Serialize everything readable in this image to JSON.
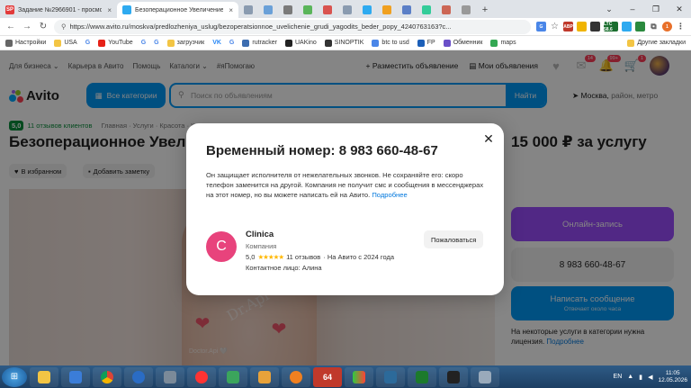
{
  "browser": {
    "tabs": [
      {
        "label": "Задание №2966901 - просмотр з",
        "fav": "SP",
        "color": "#e23a3a"
      },
      {
        "label": "Безоперационное Увеличение ]",
        "fav": "",
        "color": "#2eaaf0"
      },
      {
        "label": "",
        "fav": "",
        "color": "#8a9bb0"
      },
      {
        "label": "",
        "fav": "",
        "color": "#8a9bb0"
      },
      {
        "label": "",
        "fav": "",
        "color": "#8a9bb0"
      }
    ],
    "url": "https://www.avito.ru/moskva/predlozheniya_uslug/bezoperatsionnoe_uvelichenie_grudi_yagodits_beder_popy_4240763163?c...",
    "ext_labels": [
      "ABP",
      "LTC 58.6",
      "1"
    ],
    "bookmarks": [
      "Настройки",
      "USA",
      "G",
      "YouTube",
      "G",
      "G",
      "загрузчик",
      "VK",
      "G",
      "rutracker",
      "UAKino",
      "SINOPTIK",
      "btc to usd",
      "FP",
      "Обменник",
      "maps",
      "Другие закладки"
    ]
  },
  "avito": {
    "topnav": [
      "Для бизнеса ⌄",
      "Карьера в Авито",
      "Помощь",
      "Каталоги ⌄",
      "#яПомогаю"
    ],
    "post_ad": "+ Разместить объявление",
    "my_ads": "Мои объявления",
    "badges": {
      "messages": "14",
      "notifications": "99+",
      "cart": "1"
    },
    "logo": "Avito",
    "categories_button": "Все категории",
    "search_placeholder": "Поиск по объявлениям",
    "search_button": "Найти",
    "location_city": "Москва,",
    "location_hint": "район, метро",
    "rating_value": "5,0",
    "rating_text": "11 отзывов клиентов",
    "breadcrumbs": "Главная  ·  Услуги  ·  Красота  ·  Косметология",
    "title": "Безоперационное Увеличение груди",
    "price": "15 000 ₽ за услугу",
    "favorite": "В избранном",
    "note": "Добавить заметку",
    "watermark": "Dr.Api",
    "watermark_small": "Doctor.Api 🤍",
    "online_booking": "Онлайн-запись",
    "phone_button": "8 983 660-48-67",
    "write_message": "Написать сообщение",
    "reply_time": "Отвечает около часа",
    "license_notice": "На некоторые услуги в категории нужна лицензия.",
    "license_link": "Подробнее"
  },
  "modal": {
    "title_prefix": "Временный номер:",
    "title_number": "8 983 660-48-67",
    "description": "Он защищает исполнителя от нежелательных звонков. Не сохраняйте его: скоро телефон заменится на другой. Компания не получит смс и сообщения в мессенджерах на этот номер, но вы можете написать ей на Авито.",
    "more_link": "Подробнее",
    "seller_initial": "C",
    "seller_name": "Clinica",
    "seller_type": "Компания",
    "seller_rating": "5,0",
    "seller_stars": "★★★★★",
    "seller_reviews": "11 отзывов",
    "seller_since": "· На Авито с 2024 года",
    "seller_contact": "Контактное лицо: Алина",
    "complain_button": "Пожаловаться"
  },
  "taskbar": {
    "lang": "EN",
    "time": "11:05",
    "date": "12.05.2026",
    "counter": "64"
  }
}
